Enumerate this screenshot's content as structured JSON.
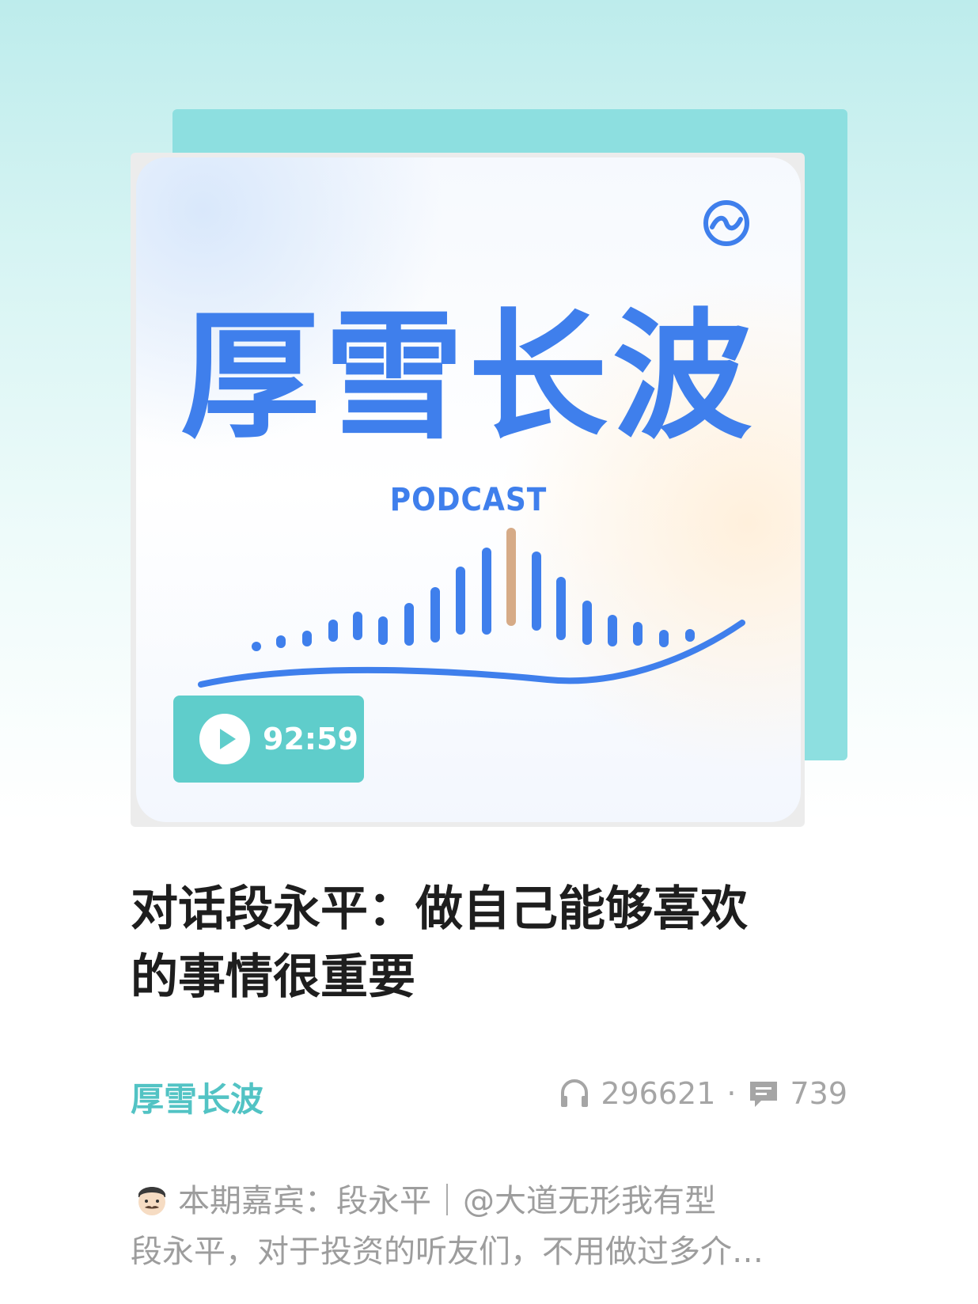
{
  "cover": {
    "title": "厚雪长波",
    "subtitle": "PODCAST",
    "logo_icon": "brand-logo-icon",
    "accent_color": "#3f7fec",
    "wave_highlight_color": "#d6ab87"
  },
  "player": {
    "play_icon": "play-icon",
    "duration": "92:59"
  },
  "episode": {
    "title": "对话段永平：做自己能够喜欢的事情很重要",
    "channel": "厚雪长波",
    "listens": "296621",
    "separator": "·",
    "comments": "739",
    "listens_icon": "headphones-icon",
    "comments_icon": "comment-icon"
  },
  "description": {
    "avatar_icon": "man-emoji-icon",
    "line1": "本期嘉宾：段永平｜@大道无形我有型",
    "line2": "段永平，对于投资的听友们，不用做过多介…"
  },
  "colors": {
    "teal": "#5fcdcb",
    "channel": "#52c3c4",
    "muted": "#a5a5a5"
  }
}
